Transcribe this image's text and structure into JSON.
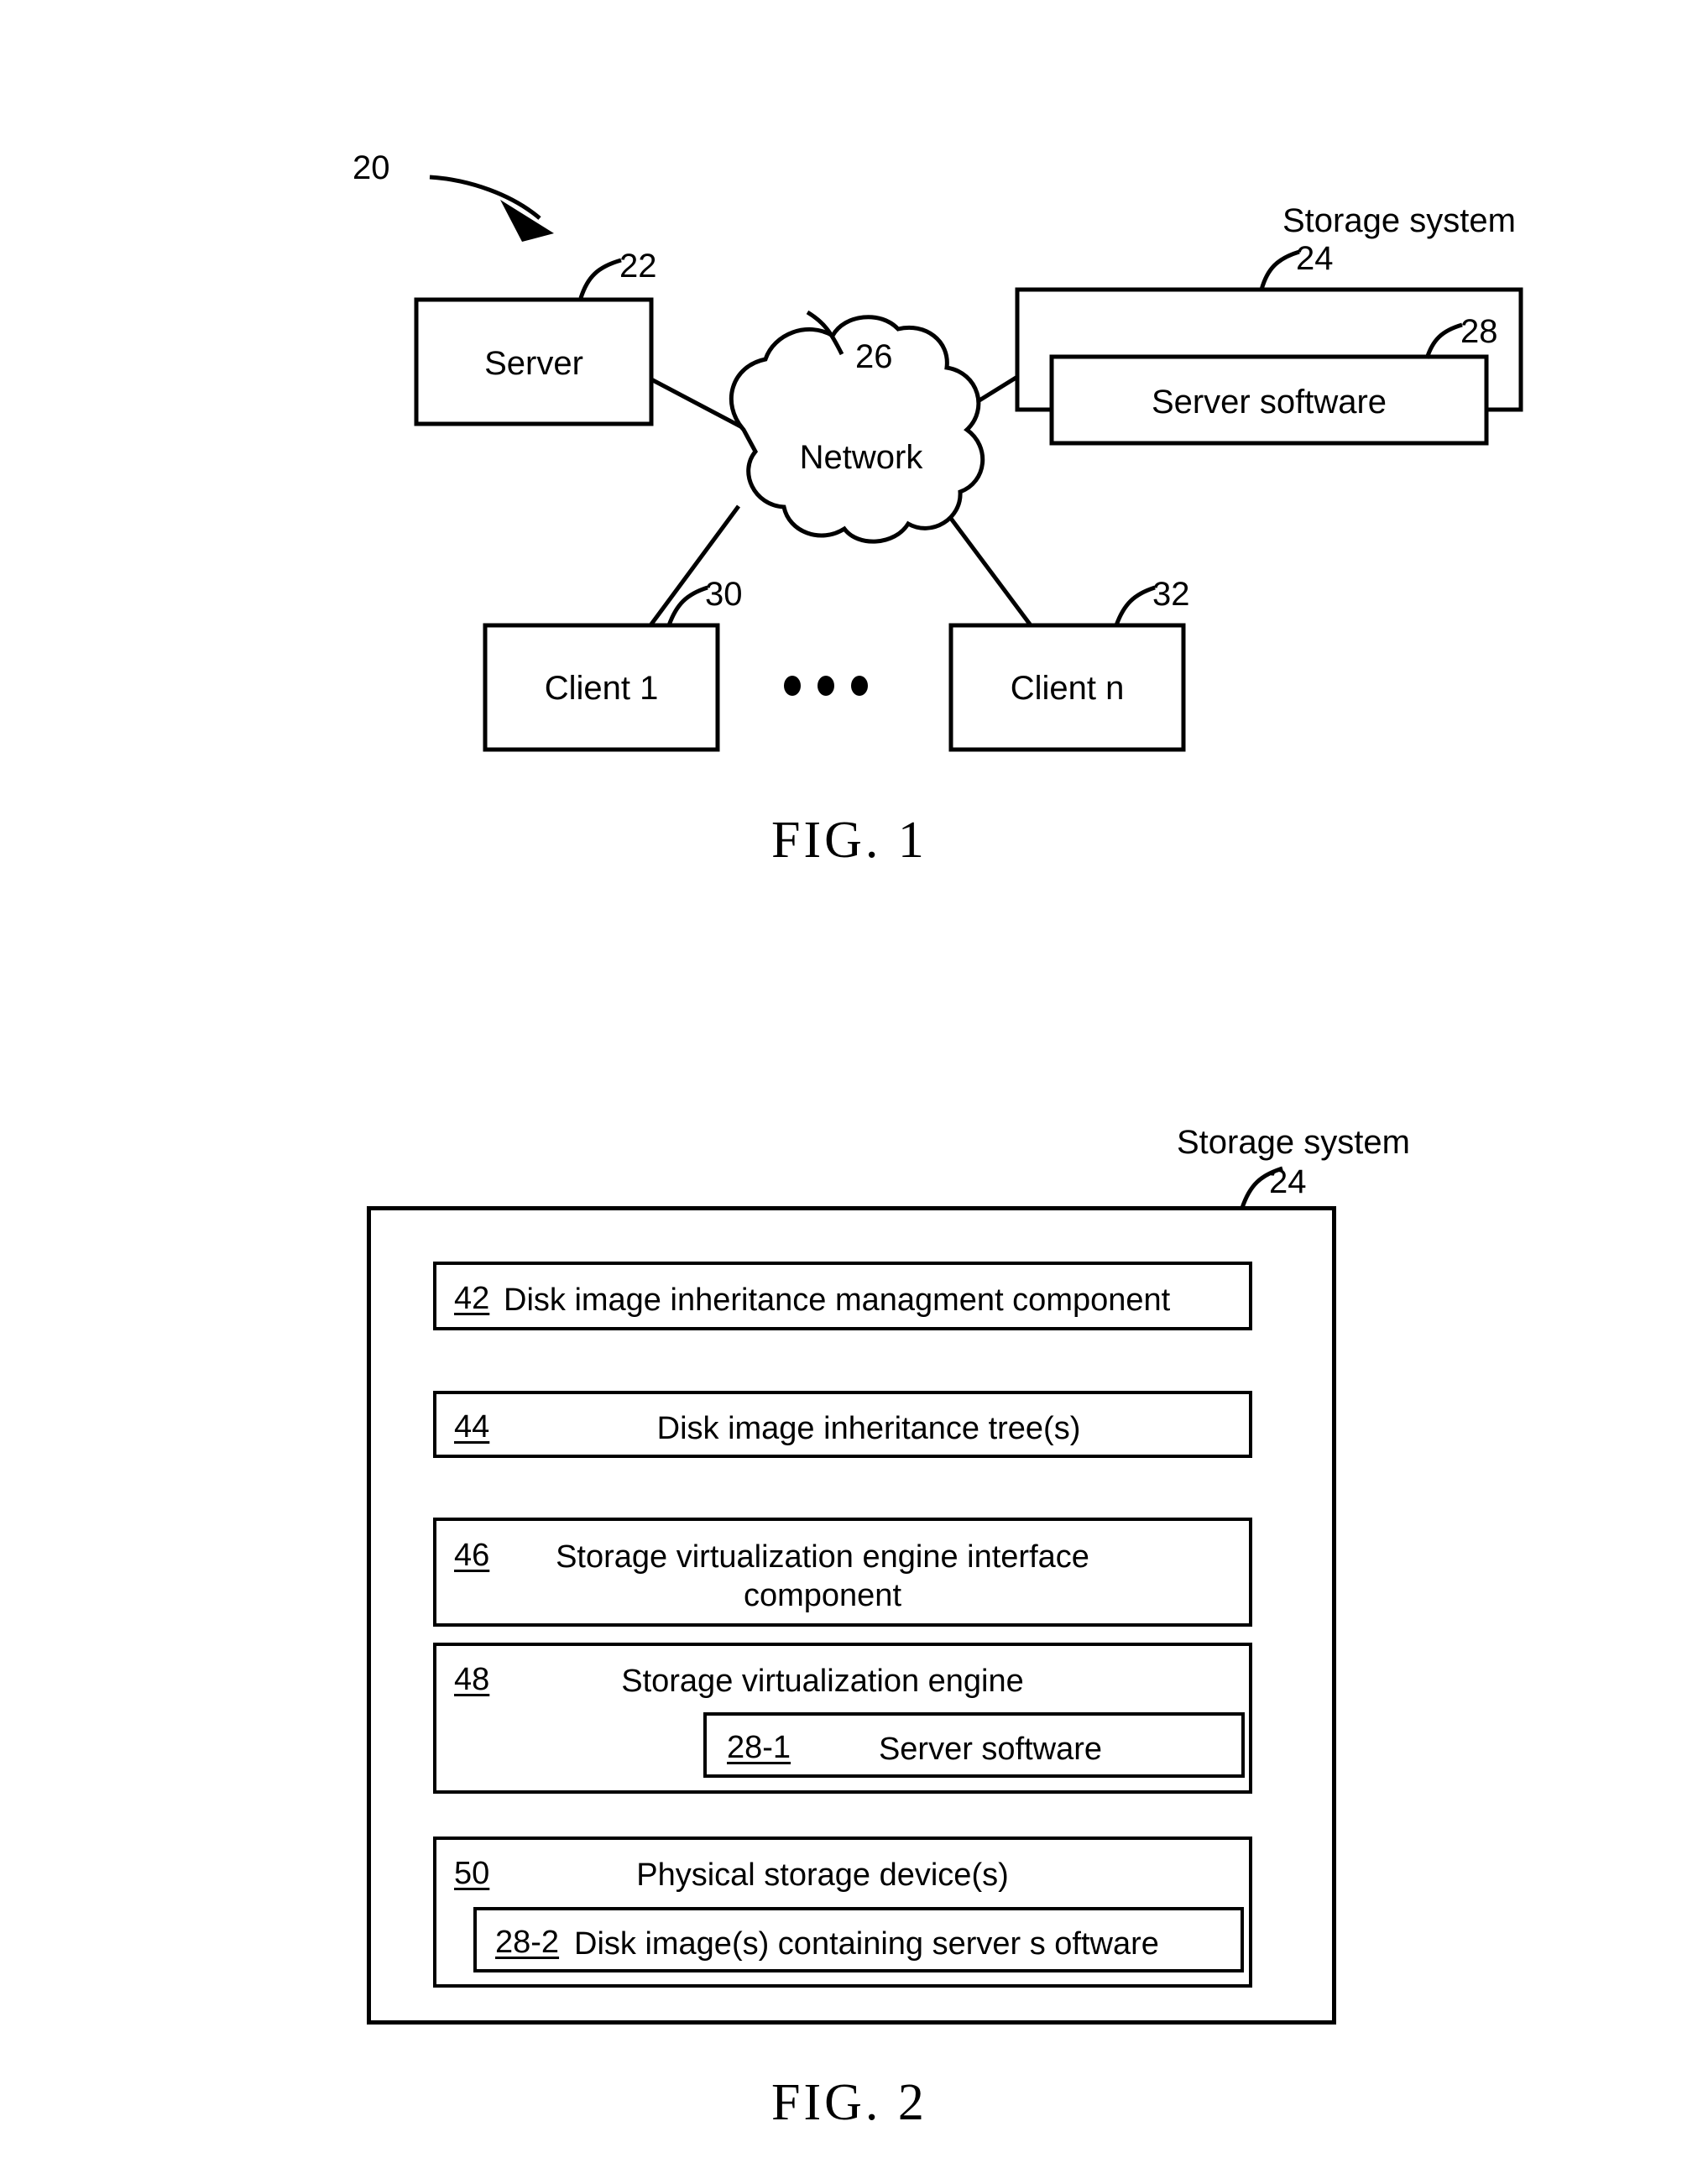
{
  "document": {
    "type": "patent-drawing-sheet"
  },
  "fig1": {
    "caption": "FIG. 1",
    "system_ref": "20",
    "storage_system_label": "Storage system",
    "nodes": {
      "server": {
        "ref": "22",
        "label": "Server"
      },
      "network": {
        "ref": "26",
        "label": "Network"
      },
      "storage_system": {
        "ref": "24"
      },
      "server_software": {
        "ref": "28",
        "label": "Server software"
      },
      "client_1": {
        "ref": "30",
        "label": "Client 1"
      },
      "client_n": {
        "ref": "32",
        "label": "Client n"
      }
    },
    "ellipsis": "•••"
  },
  "fig2": {
    "caption": "FIG. 2",
    "storage_system_label": "Storage system",
    "storage_system_ref": "24",
    "components": [
      {
        "ref": "42",
        "label": "Disk image inheritance managment component",
        "align": "left"
      },
      {
        "ref": "44",
        "label": "Disk image inheritance tree(s)",
        "align": "center"
      },
      {
        "ref": "46",
        "label": "Storage virtualization engine interface component",
        "align": "center"
      },
      {
        "ref": "48",
        "label": "Storage virtualization engine",
        "align": "center",
        "child": {
          "ref": "28-1",
          "label": "Server software"
        }
      },
      {
        "ref": "50",
        "label": "Physical storage device(s)",
        "align": "center",
        "child": {
          "ref": "28-2",
          "label": "Disk image(s) containing server s oftware"
        }
      }
    ]
  },
  "colors": {
    "ink": "#000000",
    "paper": "#ffffff"
  }
}
